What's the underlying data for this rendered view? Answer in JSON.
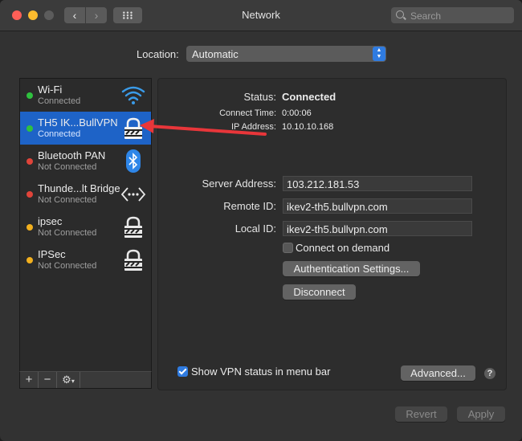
{
  "window": {
    "title": "Network"
  },
  "search": {
    "placeholder": "Search"
  },
  "location": {
    "label": "Location:",
    "value": "Automatic"
  },
  "services": [
    {
      "name": "Wi-Fi",
      "status": "Connected",
      "dot": "#2fc13f",
      "icon": "wifi-icon"
    },
    {
      "name": "TH5 IK...BullVPN",
      "status": "Connected",
      "dot": "#2fc13f",
      "icon": "lock-icon"
    },
    {
      "name": "Bluetooth PAN",
      "status": "Not Connected",
      "dot": "#e0443a",
      "icon": "bluetooth-icon"
    },
    {
      "name": "Thunde...lt Bridge",
      "status": "Not Connected",
      "dot": "#e0443a",
      "icon": "thunderbolt-bridge-icon"
    },
    {
      "name": "ipsec",
      "status": "Not Connected",
      "dot": "#f2b01e",
      "icon": "lock-icon"
    },
    {
      "name": "IPSec",
      "status": "Not Connected",
      "dot": "#f2b01e",
      "icon": "lock-icon"
    }
  ],
  "toolbar": {
    "add": "+",
    "remove": "−",
    "gear": "⚙"
  },
  "detail": {
    "status_label": "Status:",
    "status_value": "Connected",
    "connect_time_label": "Connect Time:",
    "connect_time_value": "0:00:06",
    "ip_label": "IP Address:",
    "ip_value": "10.10.10.168",
    "server_label": "Server Address:",
    "server_value": "103.212.181.53",
    "remote_label": "Remote ID:",
    "remote_value": "ikev2-th5.bullvpn.com",
    "local_label": "Local ID:",
    "local_value": "ikev2-th5.bullvpn.com",
    "connect_on_demand": "Connect on demand",
    "auth_button": "Authentication Settings...",
    "disconnect_button": "Disconnect",
    "show_vpn_status": "Show VPN status in menu bar",
    "advanced_button": "Advanced...",
    "help": "?"
  },
  "footer": {
    "revert": "Revert",
    "apply": "Apply"
  },
  "colors": {
    "accent": "#2f7be0",
    "selection": "#1e63c7",
    "annotation_arrow": "#e8363a"
  }
}
